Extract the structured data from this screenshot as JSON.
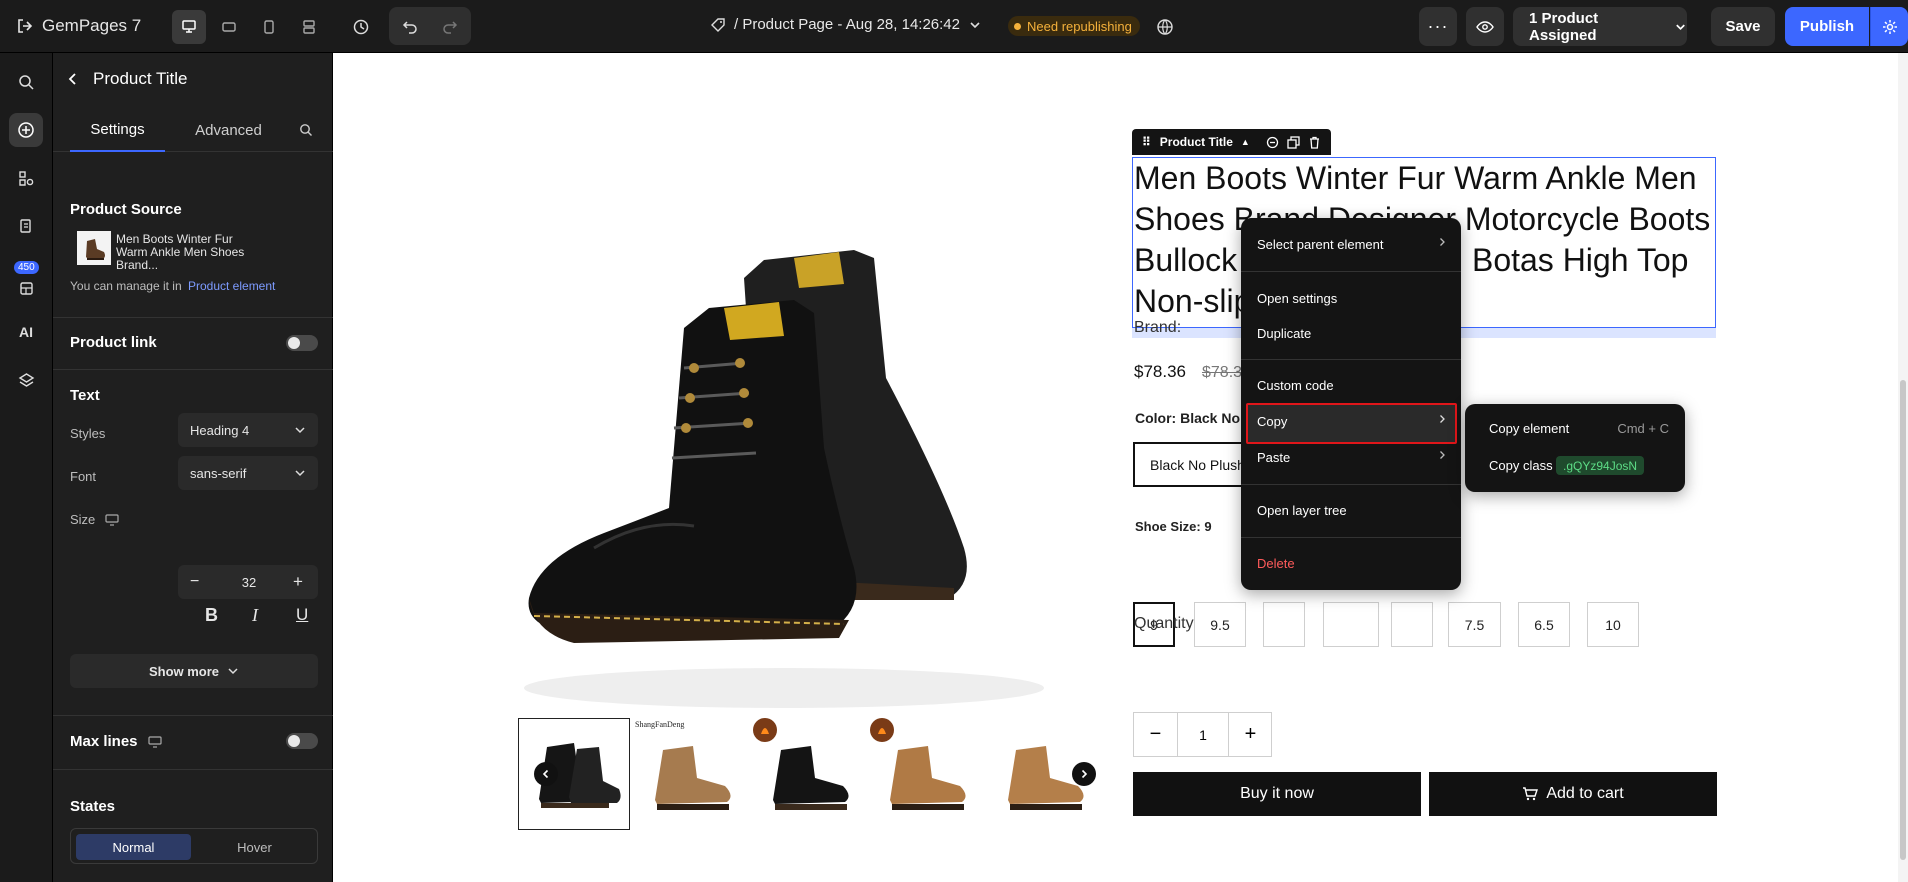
{
  "topbar": {
    "app_name": "GemPages 7",
    "page_title": "/ Product Page - Aug 28, 14:26:42",
    "republish_label": "Need republishing",
    "assigned_label": "1 Product Assigned",
    "save_label": "Save",
    "publish_label": "Publish"
  },
  "rail": {
    "badge": "450"
  },
  "panel": {
    "header_title": "Product Title",
    "tabs": [
      "Settings",
      "Advanced"
    ],
    "product_source": {
      "title": "Product Source",
      "product_name": "Men Boots Winter Fur Warm Ankle Men Shoes Brand...",
      "manage_text": "You can manage it in",
      "manage_link": "Product element"
    },
    "product_link_label": "Product link",
    "text_section": {
      "title": "Text",
      "styles_label": "Styles",
      "styles_value": "Heading 4",
      "font_label": "Font",
      "font_value": "sans-serif",
      "size_label": "Size",
      "size_value": "32",
      "show_more": "Show more"
    },
    "max_lines_label": "Max lines",
    "states": {
      "title": "States",
      "options": [
        "Normal",
        "Hover"
      ],
      "active": "Normal"
    }
  },
  "canvas": {
    "selection_label": "Product Title",
    "product_title": "Men Boots Winter Fur Warm Ankle Men Shoes Brand Designer Motorcycle Boots Bullock Leather Casual Botas High Top Non-slip",
    "brand_label": "Brand:",
    "price": "$78.36",
    "compare_price": "$78.36",
    "color_label": "Color: Black No",
    "color_option": "Black No Plush",
    "size_label": "Shoe Size: 9",
    "sizes": [
      "9",
      "9.5",
      "",
      "",
      "",
      "7.5",
      "6.5",
      "10"
    ],
    "selected_size": "9",
    "quantity_label": "Quantity",
    "quantity": "1",
    "buy_now": "Buy it now",
    "add_to_cart": "Add to cart",
    "thumb_brand_text": "ShangFanDeng"
  },
  "context_menu": {
    "items": [
      "Select parent element",
      "Open settings",
      "Duplicate",
      "Custom code",
      "Copy",
      "Paste",
      "Open layer tree",
      "Delete"
    ],
    "delete_color": "#ff5b5b"
  },
  "copy_submenu": {
    "copy_element": "Copy element",
    "shortcut": "Cmd + C",
    "copy_class": "Copy class",
    "class_name": ".gQYz94JosN"
  },
  "colors": {
    "accent": "#3c67ff",
    "topbar_bg": "#1b1b1b",
    "warning": "#f5b13b",
    "highlight_red": "#e0161a"
  }
}
